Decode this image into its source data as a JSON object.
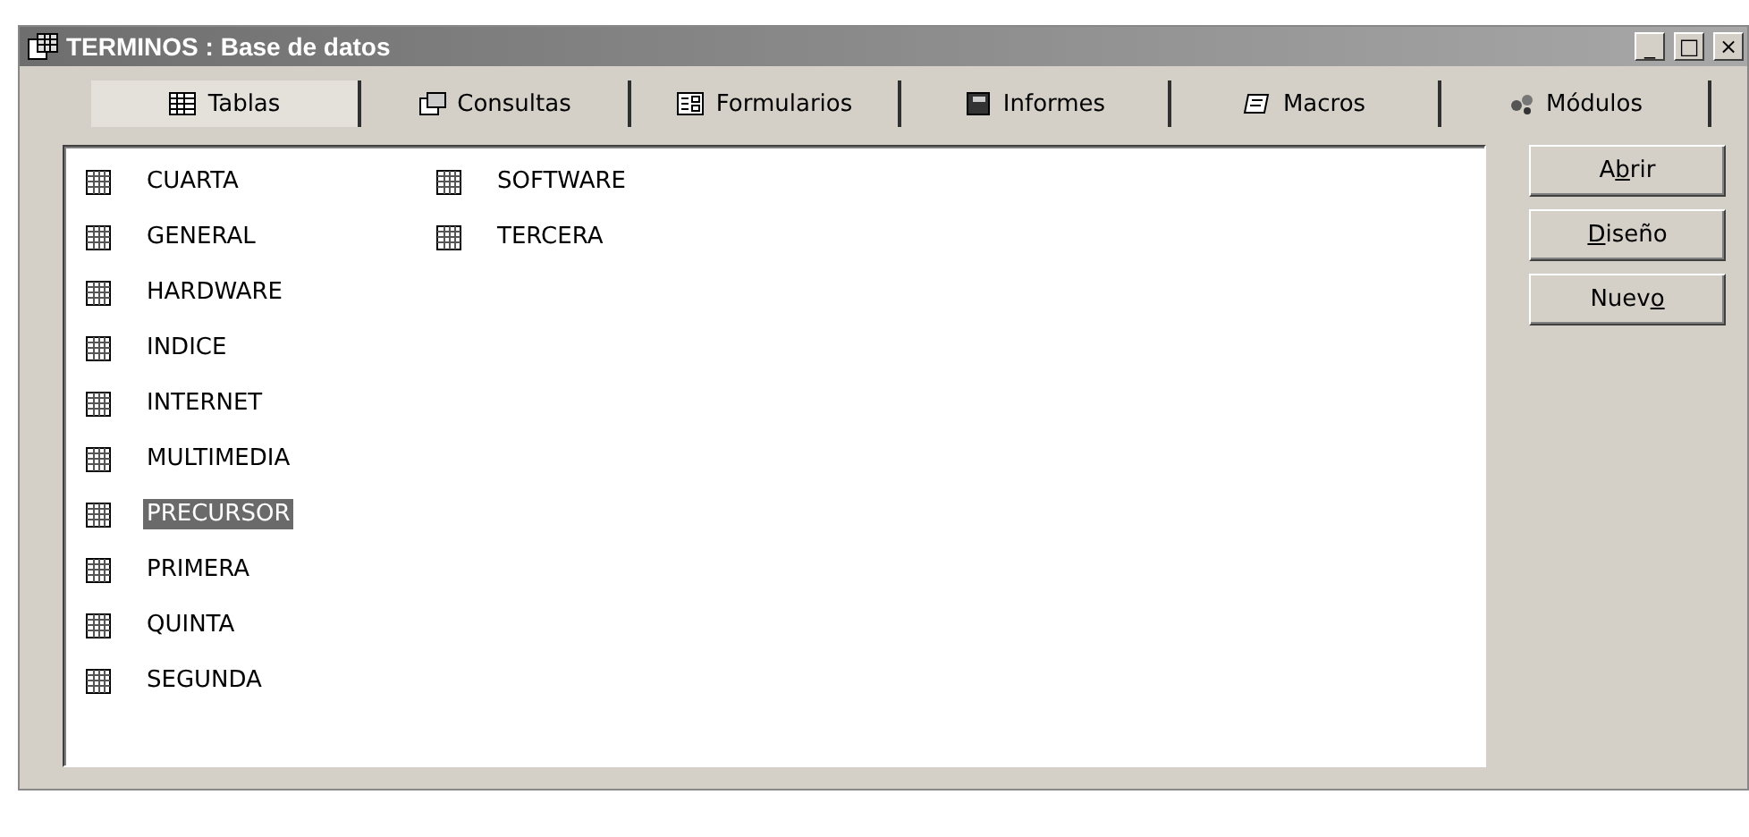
{
  "window": {
    "title": "TERMINOS : Base de datos",
    "controls": [
      "_",
      "□",
      "×"
    ]
  },
  "tabs": [
    {
      "label": "Tablas",
      "kind": "table",
      "selected": true
    },
    {
      "label": "Consultas",
      "kind": "query",
      "selected": false
    },
    {
      "label": "Formularios",
      "kind": "form",
      "selected": false
    },
    {
      "label": "Informes",
      "kind": "report",
      "selected": false
    },
    {
      "label": "Macros",
      "kind": "macro",
      "selected": false
    },
    {
      "label": "Módulos",
      "kind": "module",
      "selected": false
    }
  ],
  "objects": [
    {
      "name": "CUARTA",
      "selected": false
    },
    {
      "name": "GENERAL",
      "selected": false
    },
    {
      "name": "HARDWARE",
      "selected": false
    },
    {
      "name": "INDICE",
      "selected": false
    },
    {
      "name": "INTERNET",
      "selected": false
    },
    {
      "name": "MULTIMEDIA",
      "selected": false
    },
    {
      "name": "PRECURSOR",
      "selected": true
    },
    {
      "name": "PRIMERA",
      "selected": false
    },
    {
      "name": "QUINTA",
      "selected": false
    },
    {
      "name": "SEGUNDA",
      "selected": false
    },
    {
      "name": "SOFTWARE",
      "selected": false
    },
    {
      "name": "TERCERA",
      "selected": false
    }
  ],
  "buttons": [
    {
      "before": "A",
      "key": "b",
      "after": "rir"
    },
    {
      "key": "D",
      "after": "iseño"
    },
    {
      "before": "Nuev",
      "key": "o"
    }
  ]
}
